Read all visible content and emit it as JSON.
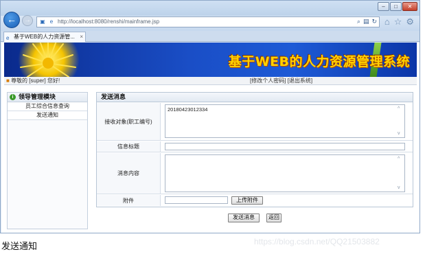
{
  "browser": {
    "address": "http://localhost:8080/renshi/mainframe.jsp",
    "tab_title": "基于WEB的人力资源管...",
    "tab_close": "×",
    "controls": {
      "minimize": "–",
      "maximize": "□",
      "close": "✕"
    }
  },
  "header": {
    "title": "基于WEB的人力资源管理系统"
  },
  "userbar": {
    "greeting": "尊敬的 [super] 您好!",
    "change_password": "[修改个人密码]",
    "logout": "[退出系统]"
  },
  "sidebar": {
    "title": "领导管理模块",
    "items": [
      {
        "label": "员工综合信息查询"
      },
      {
        "label": "发送通知"
      }
    ]
  },
  "form": {
    "title": "发送消息",
    "recipient_label": "接收对象(职工编号)",
    "recipient_value": "20180423012334",
    "subject_label": "信息标题",
    "subject_value": "",
    "content_label": "消息内容",
    "content_value": "",
    "attachment_label": "附件",
    "upload_button": "上传附件",
    "send_button": "发送消息",
    "back_button": "返回"
  },
  "caption": "发送通知",
  "watermark": "https://blog.csdn.net/QQ21503882",
  "colors": {
    "banner_blue": "#1a4ec6",
    "title_yellow": "#ffd200"
  }
}
